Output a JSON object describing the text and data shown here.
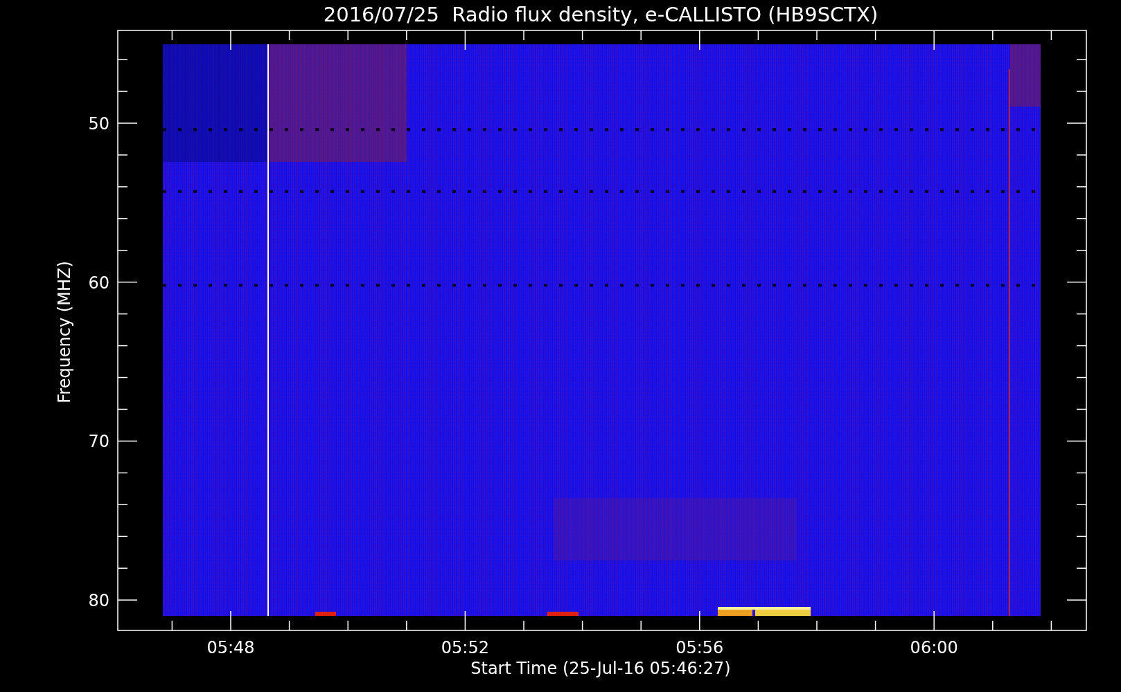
{
  "title": "2016/07/25  Radio flux density, e-CALLISTO (HB9SCTX)",
  "y_axis": {
    "label": "Frequency (MHZ)",
    "ticks": [
      "50",
      "60",
      "70",
      "80"
    ]
  },
  "x_axis": {
    "label": "Start Time (25-Jul-16 05:46:27)",
    "ticks": [
      "05:48",
      "05:52",
      "05:56",
      "06:00"
    ]
  }
}
